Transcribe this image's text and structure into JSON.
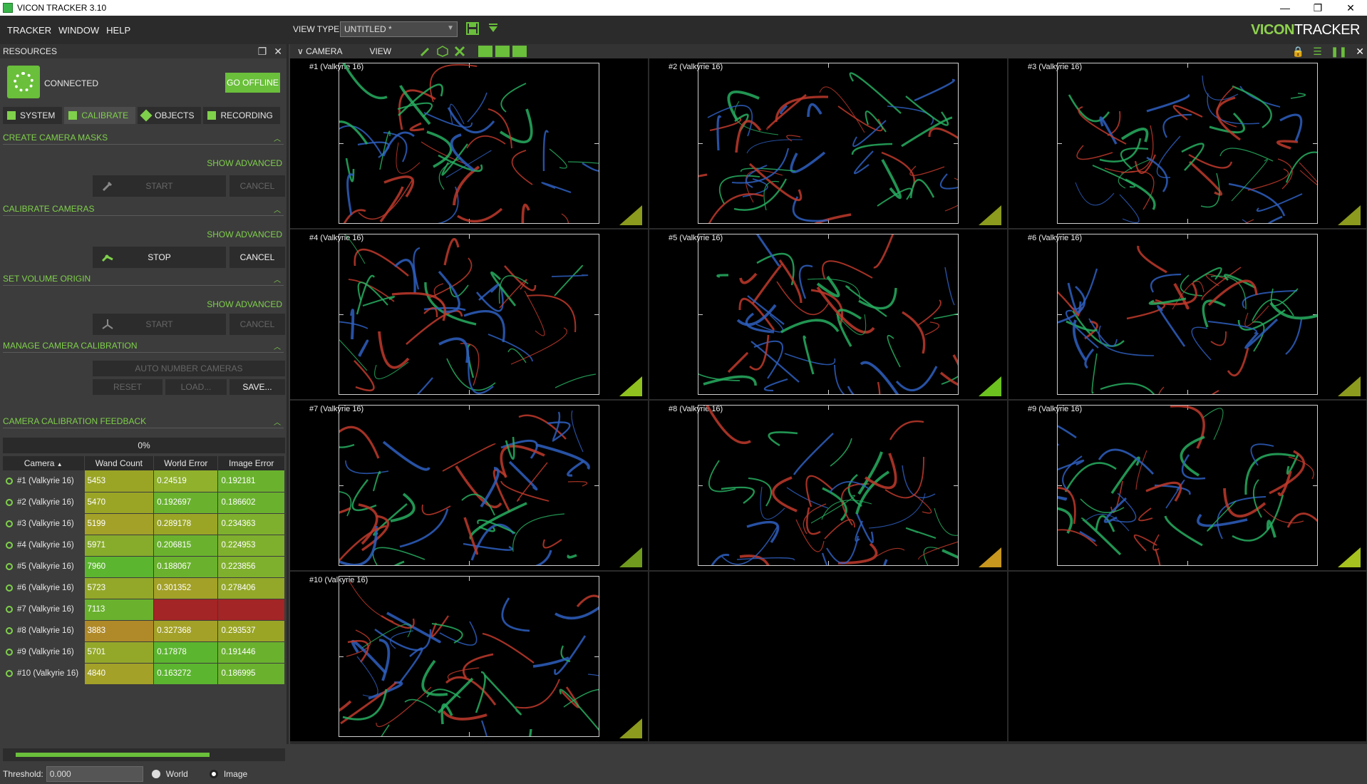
{
  "window": {
    "title": "VICON TRACKER 3.10",
    "controls": [
      "—",
      "❐",
      "✕"
    ]
  },
  "menu": {
    "items": [
      {
        "label": "TRACKER"
      },
      {
        "label": "WINDOW"
      },
      {
        "label": "HELP"
      }
    ],
    "view_type_label": "VIEW TYPE:",
    "view_type_value": "UNTITLED *"
  },
  "logo": {
    "mark": "VICON",
    "text": "TRACKER"
  },
  "resources": {
    "title": "RESOURCES",
    "status": "CONNECTED",
    "go_offline_label": "GO OFFLINE",
    "tabs": [
      {
        "label": "SYSTEM",
        "active": false
      },
      {
        "label": "CALIBRATE",
        "active": true
      },
      {
        "label": "OBJECTS",
        "active": false
      },
      {
        "label": "RECORDING",
        "active": false
      }
    ]
  },
  "sections": {
    "masks": {
      "title": "CREATE CAMERA MASKS",
      "show_advanced": "SHOW ADVANCED",
      "primary": "START",
      "secondary": "CANCEL"
    },
    "calibrate": {
      "title": "CALIBRATE CAMERAS",
      "show_advanced": "SHOW ADVANCED",
      "primary": "STOP",
      "secondary": "CANCEL"
    },
    "origin": {
      "title": "SET VOLUME ORIGIN",
      "show_advanced": "SHOW ADVANCED",
      "primary": "START",
      "secondary": "CANCEL"
    },
    "manage": {
      "title": "MANAGE CAMERA CALIBRATION",
      "auto_number": "AUTO NUMBER CAMERAS",
      "reset": "RESET",
      "load": "LOAD...",
      "save": "SAVE..."
    },
    "feedback": {
      "title": "CAMERA CALIBRATION FEEDBACK",
      "progress": "0%"
    }
  },
  "table": {
    "headers": [
      "Camera",
      "Wand Count",
      "World Error",
      "Image Error"
    ],
    "rows": [
      {
        "camera": "#1 (Valkyrie 16)",
        "wand": "5453",
        "world": "0.24519",
        "image": "0.192181",
        "wand_color": "#9aa526",
        "world_color": "#8fb12c",
        "image_color": "#6ab22e"
      },
      {
        "camera": "#2 (Valkyrie 16)",
        "wand": "5470",
        "world": "0.192697",
        "image": "0.186602",
        "wand_color": "#9aa526",
        "world_color": "#6ab22e",
        "image_color": "#6ab22e"
      },
      {
        "camera": "#3 (Valkyrie 16)",
        "wand": "5199",
        "world": "0.289178",
        "image": "0.234363",
        "wand_color": "#a3a127",
        "world_color": "#9aa526",
        "image_color": "#7fb02d"
      },
      {
        "camera": "#4 (Valkyrie 16)",
        "wand": "5971",
        "world": "0.206815",
        "image": "0.224953",
        "wand_color": "#87ab2b",
        "world_color": "#6ab22e",
        "image_color": "#7fb02d"
      },
      {
        "camera": "#5 (Valkyrie 16)",
        "wand": "7960",
        "world": "0.188067",
        "image": "0.223856",
        "wand_color": "#5cb52f",
        "world_color": "#6ab22e",
        "image_color": "#7fb02d"
      },
      {
        "camera": "#6 (Valkyrie 16)",
        "wand": "5723",
        "world": "0.301352",
        "image": "0.278406",
        "wand_color": "#93a829",
        "world_color": "#a3a127",
        "image_color": "#93a829"
      },
      {
        "camera": "#7 (Valkyrie 16)",
        "wand": "7113",
        "world": "",
        "image": "",
        "wand_color": "#6ab22e",
        "world_color": "#a32525",
        "image_color": "#a32525"
      },
      {
        "camera": "#8 (Valkyrie 16)",
        "wand": "3883",
        "world": "0.327368",
        "image": "0.293537",
        "wand_color": "#b08a28",
        "world_color": "#a3a127",
        "image_color": "#9aa526"
      },
      {
        "camera": "#9 (Valkyrie 16)",
        "wand": "5701",
        "world": "0.17878",
        "image": "0.191446",
        "wand_color": "#93a829",
        "world_color": "#5cb52f",
        "image_color": "#6ab22e"
      },
      {
        "camera": "#10 (Valkyrie 16)",
        "wand": "4840",
        "world": "0.163272",
        "image": "0.186995",
        "wand_color": "#a3a127",
        "world_color": "#5cb52f",
        "image_color": "#6ab22e"
      }
    ]
  },
  "threshold": {
    "label": "Threshold:",
    "value": "0.000",
    "world_label": "World",
    "image_label": "Image"
  },
  "viewpane": {
    "camera_label": "CAMERA",
    "view_label": "VIEW",
    "cameras": [
      {
        "label": "#1 (Valkyrie 16)",
        "tri_color": "#8c9a1e"
      },
      {
        "label": "#2 (Valkyrie 16)",
        "tri_color": "#8c9a1e"
      },
      {
        "label": "#3 (Valkyrie 16)",
        "tri_color": "#8c9a1e"
      },
      {
        "label": "#4 (Valkyrie 16)",
        "tri_color": "#8fc21e"
      },
      {
        "label": "#5 (Valkyrie 16)",
        "tri_color": "#6cc21e"
      },
      {
        "label": "#6 (Valkyrie 16)",
        "tri_color": "#8c9a1e"
      },
      {
        "label": "#7 (Valkyrie 16)",
        "tri_color": "#6f9a1e"
      },
      {
        "label": "#8 (Valkyrie 16)",
        "tri_color": "#c7971e"
      },
      {
        "label": "#9 (Valkyrie 16)",
        "tri_color": "#a6c21e"
      },
      {
        "label": "#10 (Valkyrie 16)",
        "tri_color": "#8c9a1e"
      }
    ]
  },
  "colors": {
    "accent": "#7fd04b",
    "button_green": "#6abf3b",
    "error_red": "#a32525"
  }
}
